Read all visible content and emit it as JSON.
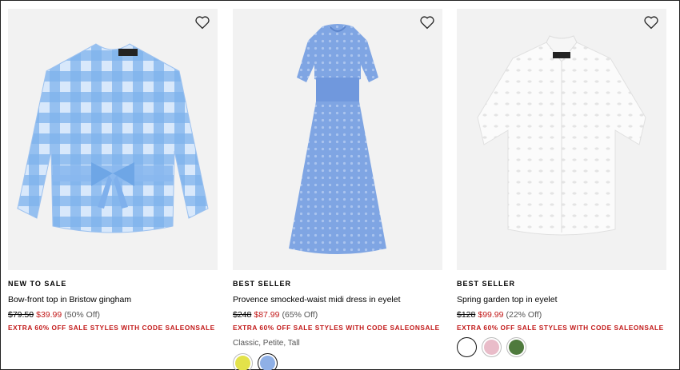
{
  "products": [
    {
      "badge": "NEW TO SALE",
      "name": "Bow-front top in Bristow gingham",
      "was_price": "$79.50",
      "sale_price": "$39.99",
      "discount": "(50% Off)",
      "promo": "EXTRA 60% OFF SALE STYLES WITH CODE SALEONSALE",
      "image_icon": "gingham-blouse-image",
      "favorite_icon": "heart-outline-icon"
    },
    {
      "badge": "BEST SELLER",
      "name": "Provence smocked-waist midi dress in eyelet",
      "was_price": "$248",
      "sale_price": "$87.99",
      "discount": "(65% Off)",
      "promo": "EXTRA 60% OFF SALE STYLES WITH CODE SALEONSALE",
      "fits": "Classic, Petite, Tall",
      "swatches": [
        "#e3e24a",
        "#8fb0e6"
      ],
      "selected_swatch": 1,
      "image_icon": "blue-eyelet-dress-image",
      "favorite_icon": "heart-outline-icon"
    },
    {
      "badge": "BEST SELLER",
      "name": "Spring garden top in eyelet",
      "was_price": "$128",
      "sale_price": "$99.99",
      "discount": "(22% Off)",
      "promo": "EXTRA 60% OFF SALE STYLES WITH CODE SALEONSALE",
      "swatches": [
        "#ffffff",
        "#e9bcc9",
        "#4f7a3d"
      ],
      "selected_swatch": 0,
      "image_icon": "white-eyelet-shirt-image",
      "favorite_icon": "heart-outline-icon"
    }
  ],
  "colors": {
    "sale": "#c21a1a",
    "image_bg": "#f2f2f2"
  }
}
